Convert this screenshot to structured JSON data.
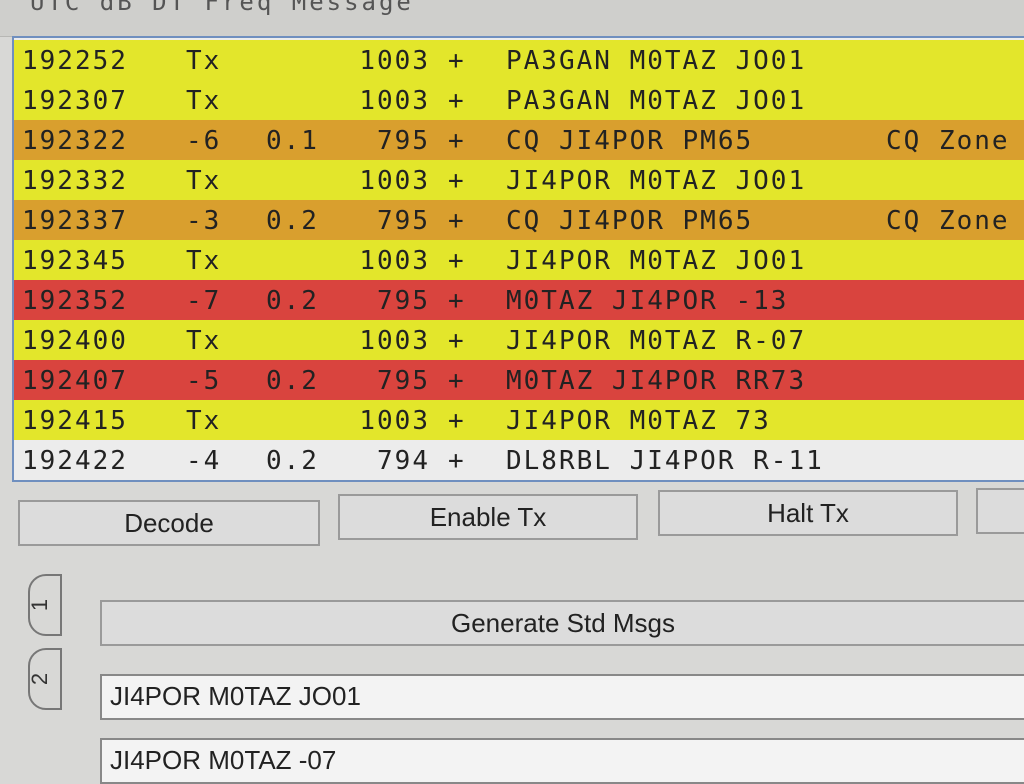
{
  "header": {
    "columns_text": "UTC   dB   DT Freq   Message"
  },
  "colors": {
    "tx_row": "#e3e62b",
    "cq_row": "#d99f2e",
    "to_me_row": "#d9443e",
    "plain_row": "#ececec"
  },
  "decodes": [
    {
      "time": "192252",
      "db": "Tx",
      "dt": "",
      "freq": "1003",
      "mode": "+",
      "message": "PA3GAN M0TAZ JO01",
      "note": ""
    },
    {
      "time": "192307",
      "db": "Tx",
      "dt": "",
      "freq": "1003",
      "mode": "+",
      "message": "PA3GAN M0TAZ JO01",
      "note": ""
    },
    {
      "time": "192322",
      "db": "-6",
      "dt": "0.1",
      "freq": "795",
      "mode": "+",
      "message": "CQ JI4POR PM65",
      "note": "CQ Zone"
    },
    {
      "time": "192332",
      "db": "Tx",
      "dt": "",
      "freq": "1003",
      "mode": "+",
      "message": "JI4POR M0TAZ JO01",
      "note": ""
    },
    {
      "time": "192337",
      "db": "-3",
      "dt": "0.2",
      "freq": "795",
      "mode": "+",
      "message": "CQ JI4POR PM65",
      "note": "CQ Zone"
    },
    {
      "time": "192345",
      "db": "Tx",
      "dt": "",
      "freq": "1003",
      "mode": "+",
      "message": "JI4POR M0TAZ JO01",
      "note": ""
    },
    {
      "time": "192352",
      "db": "-7",
      "dt": "0.2",
      "freq": "795",
      "mode": "+",
      "message": "M0TAZ JI4POR -13",
      "note": ""
    },
    {
      "time": "192400",
      "db": "Tx",
      "dt": "",
      "freq": "1003",
      "mode": "+",
      "message": "JI4POR M0TAZ R-07",
      "note": ""
    },
    {
      "time": "192407",
      "db": "-5",
      "dt": "0.2",
      "freq": "795",
      "mode": "+",
      "message": "M0TAZ JI4POR RR73",
      "note": ""
    },
    {
      "time": "192415",
      "db": "Tx",
      "dt": "",
      "freq": "1003",
      "mode": "+",
      "message": "JI4POR M0TAZ 73",
      "note": ""
    },
    {
      "time": "192422",
      "db": "-4",
      "dt": "0.2",
      "freq": "794",
      "mode": "+",
      "message": "DL8RBL JI4POR R-11",
      "note": ""
    }
  ],
  "row_kinds": [
    "tx",
    "tx",
    "cq",
    "tx",
    "cq",
    "tx",
    "me",
    "tx",
    "me",
    "tx",
    "plain"
  ],
  "buttons": {
    "decode": "Decode",
    "enable_tx": "Enable Tx",
    "halt_tx": "Halt Tx"
  },
  "tabs": {
    "tab1": "1",
    "tab2": "2"
  },
  "messages": {
    "generate": "Generate Std Msgs",
    "tx1": "JI4POR M0TAZ JO01",
    "tx2": "JI4POR M0TAZ -07"
  }
}
